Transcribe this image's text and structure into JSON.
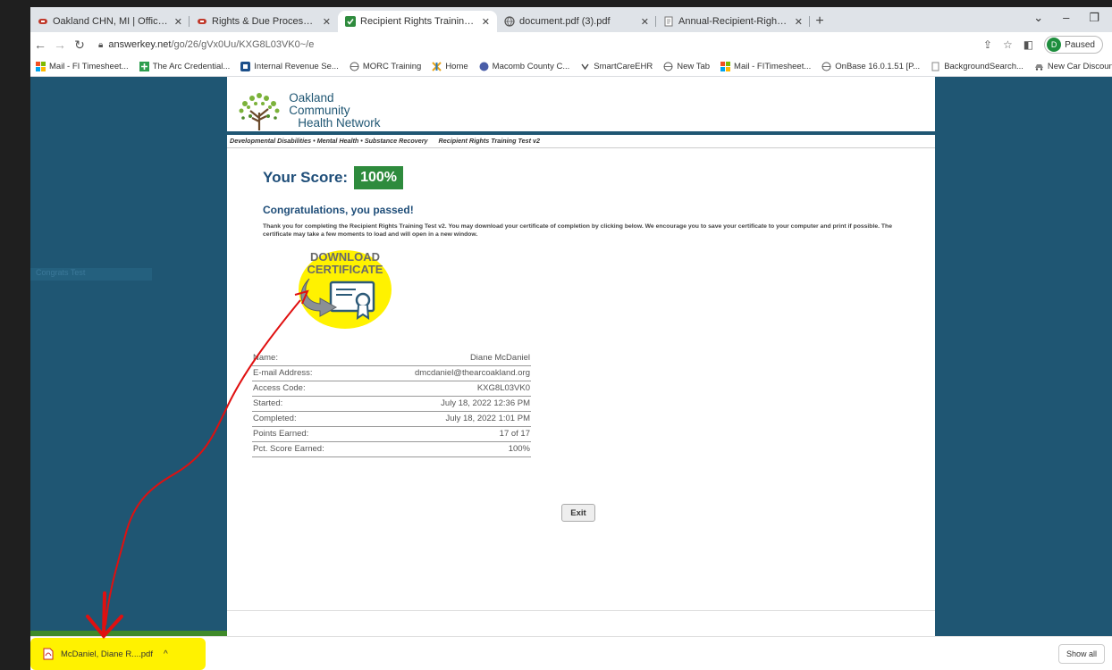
{
  "browser": {
    "tabs": [
      {
        "title": "Oakland CHN, MI | Official Webs",
        "icon": "ochn-favicon",
        "active": false
      },
      {
        "title": "Rights & Due Process Training | C",
        "icon": "ochn-favicon",
        "active": false
      },
      {
        "title": "Recipient Rights Training Test v2",
        "icon": "checkmark-favicon",
        "active": true
      },
      {
        "title": "document.pdf (3).pdf",
        "icon": "globe-favicon",
        "active": false
      },
      {
        "title": "Annual-Recipient-Rights-Training",
        "icon": "document-favicon",
        "active": false
      }
    ],
    "url_host": "answerkey.net",
    "url_path": "/go/26/gVx0Uu/KXG8L03VK0~/e",
    "profile_initial": "D",
    "profile_status": "Paused",
    "bookmarks": [
      {
        "label": "Mail - FI Timesheet...",
        "icon": "ms-icon"
      },
      {
        "label": "The Arc Credential...",
        "icon": "plus-icon"
      },
      {
        "label": "Internal Revenue Se...",
        "icon": "irs-icon"
      },
      {
        "label": "MORC Training",
        "icon": "globe-icon"
      },
      {
        "label": "Home",
        "icon": "home-bm-icon"
      },
      {
        "label": "Macomb County C...",
        "icon": "circle-icon"
      },
      {
        "label": "SmartCareEHR",
        "icon": "smartcare-icon"
      },
      {
        "label": "New Tab",
        "icon": "globe-icon"
      },
      {
        "label": "Mail - FITimesheet...",
        "icon": "ms-icon"
      },
      {
        "label": "OnBase 16.0.1.51 [P...",
        "icon": "globe-icon"
      },
      {
        "label": "BackgroundSearch...",
        "icon": "doc-icon"
      },
      {
        "label": "New Car Discounts...",
        "icon": "car-icon"
      }
    ]
  },
  "site": {
    "logo_line1": "Oakland Community",
    "logo_line2": "Health Network",
    "tagline": "Developmental Disabilities • Mental Health • Substance Recovery",
    "test_name": "Recipient Rights Training Test v2"
  },
  "result": {
    "score_label": "Your Score:",
    "score_value": "100%",
    "congrats": "Congratulations, you passed!",
    "message": "Thank you for completing the Recipient Rights Training Test v2. You may download your certificate of completion by clicking below. We encourage you to save your certificate to your computer and print if possible. The certificate may take a few moments to load and will open in a new window.",
    "cert_line1": "DOWNLOAD",
    "cert_line2": "CERTIFICATE",
    "rows": [
      {
        "label": "Name:",
        "value": "Diane McDaniel"
      },
      {
        "label": "E-mail Address:",
        "value": "dmcdaniel@thearcoakland.org"
      },
      {
        "label": "Access Code:",
        "value": "KXG8L03VK0"
      },
      {
        "label": "Started:",
        "value": "July 18, 2022 12:36 PM"
      },
      {
        "label": "Completed:",
        "value": "July 18, 2022 1:01 PM"
      },
      {
        "label": "Points Earned:",
        "value": "17 of 17"
      },
      {
        "label": "Pct. Score Earned:",
        "value": "100%"
      }
    ],
    "exit_label": "Exit"
  },
  "downloads": {
    "file_name": "McDaniel, Diane R....pdf",
    "show_all": "Show all"
  },
  "faint_text": "Congrats Test",
  "colors": {
    "page_bg": "#1f5673",
    "score_badge": "#2e8b3d",
    "heading": "#1f4e79",
    "highlight": "#fff200",
    "annotation_arrow": "#e01010"
  }
}
